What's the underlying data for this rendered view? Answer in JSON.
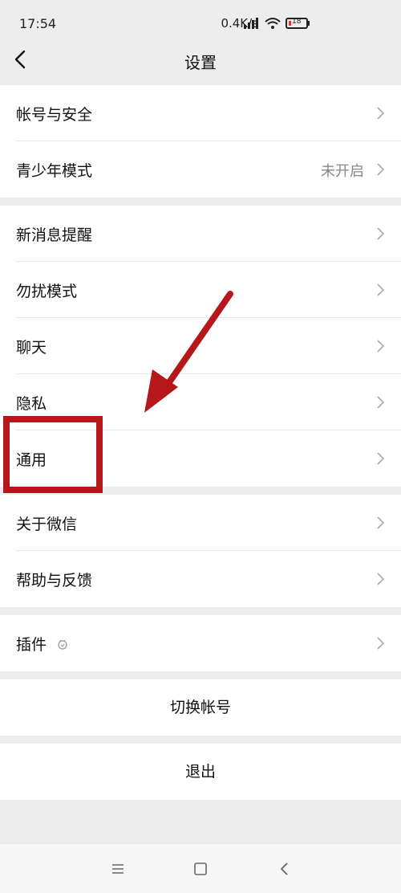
{
  "status": {
    "time": "17:54",
    "speed": "0.4K/s",
    "battery": "18"
  },
  "header": {
    "title": "设置"
  },
  "group1": [
    {
      "label": "帐号与安全",
      "value": ""
    },
    {
      "label": "青少年模式",
      "value": "未开启"
    }
  ],
  "group2": [
    {
      "label": "新消息提醒"
    },
    {
      "label": "勿扰模式"
    },
    {
      "label": "聊天"
    },
    {
      "label": "隐私"
    },
    {
      "label": "通用"
    }
  ],
  "group3": [
    {
      "label": "关于微信"
    },
    {
      "label": "帮助与反馈"
    }
  ],
  "group4": [
    {
      "label": "插件"
    }
  ],
  "actions": {
    "switch_account": "切换帐号",
    "logout": "退出"
  },
  "colors": {
    "annotation": "#B5171B",
    "background": "#EDEDED"
  }
}
